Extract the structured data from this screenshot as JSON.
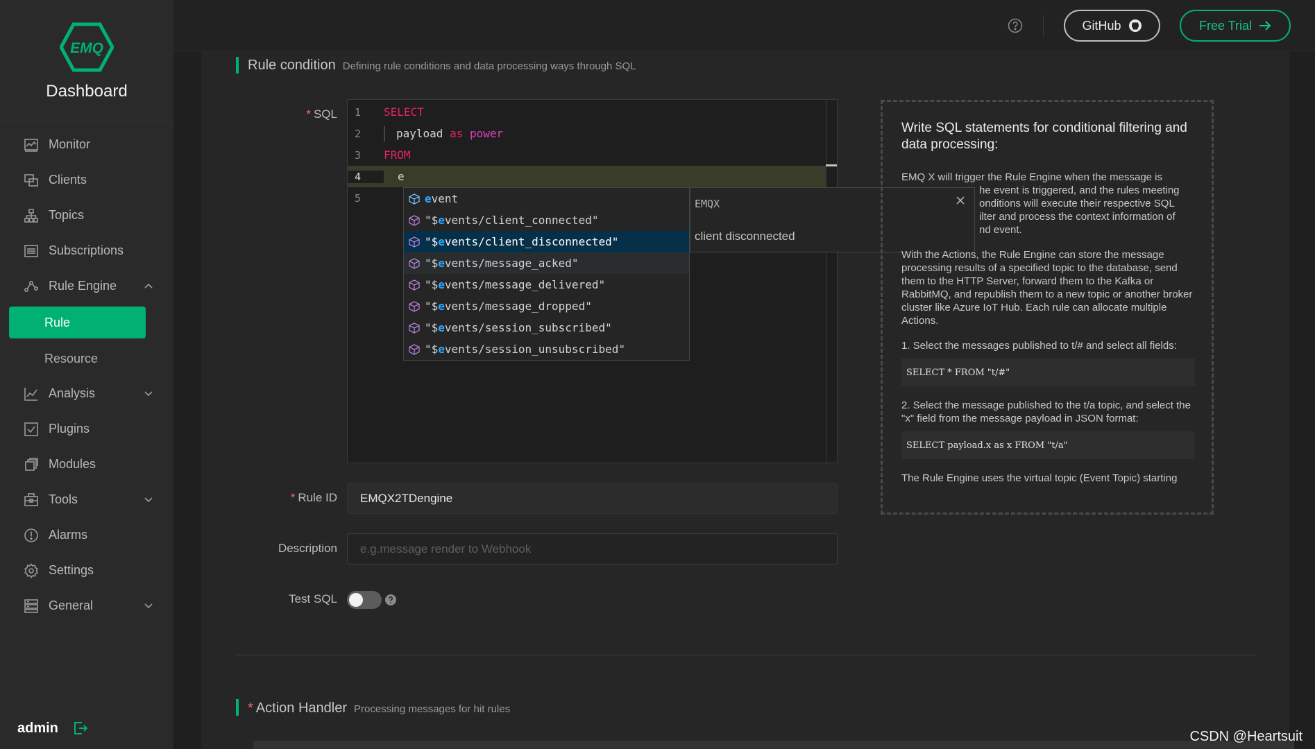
{
  "brand": {
    "logo_text": "EMQ",
    "title": "Dashboard"
  },
  "sidebar": {
    "items": [
      {
        "label": "Monitor",
        "icon": "monitor-icon"
      },
      {
        "label": "Clients",
        "icon": "clients-icon"
      },
      {
        "label": "Topics",
        "icon": "topics-icon"
      },
      {
        "label": "Subscriptions",
        "icon": "subscriptions-icon"
      },
      {
        "label": "Rule Engine",
        "icon": "rule-engine-icon",
        "expanded": true
      },
      {
        "label": "Rule",
        "active": true
      },
      {
        "label": "Resource"
      },
      {
        "label": "Analysis",
        "icon": "analysis-icon"
      },
      {
        "label": "Plugins",
        "icon": "plugins-icon"
      },
      {
        "label": "Modules",
        "icon": "modules-icon"
      },
      {
        "label": "Tools",
        "icon": "tools-icon"
      },
      {
        "label": "Alarms",
        "icon": "alarms-icon"
      },
      {
        "label": "Settings",
        "icon": "settings-icon"
      },
      {
        "label": "General",
        "icon": "general-icon"
      }
    ],
    "user": "admin"
  },
  "topbar": {
    "github_label": "GitHub",
    "trial_label": "Free Trial"
  },
  "rule_condition": {
    "title": "Rule condition",
    "subtitle": "Defining rule conditions and data processing ways through SQL",
    "sql_label": "SQL",
    "line_numbers": [
      "1",
      "2",
      "3",
      "4",
      "5"
    ],
    "code": {
      "l1_kw": "SELECT",
      "l2_field": "payload",
      "l2_as": "as",
      "l2_alias": "power",
      "l3_kw": "FROM",
      "l4_text": "e"
    },
    "suggestions": [
      {
        "prefix": "",
        "match": "e",
        "rest": "vent"
      },
      {
        "prefix": "\"$",
        "match": "e",
        "rest": "vents/client_connected\""
      },
      {
        "prefix": "\"$",
        "match": "e",
        "rest": "vents/client_disconnected\""
      },
      {
        "prefix": "\"$",
        "match": "e",
        "rest": "vents/message_acked\""
      },
      {
        "prefix": "\"$",
        "match": "e",
        "rest": "vents/message_delivered\""
      },
      {
        "prefix": "\"$",
        "match": "e",
        "rest": "vents/message_dropped\""
      },
      {
        "prefix": "\"$",
        "match": "e",
        "rest": "vents/session_subscribed\""
      },
      {
        "prefix": "\"$",
        "match": "e",
        "rest": "vents/session_unsubscribed\""
      }
    ],
    "selected_suggestion": 2,
    "detail": {
      "title": "EMQX",
      "body": "client disconnected"
    }
  },
  "form": {
    "rule_id_label": "Rule ID",
    "rule_id_value": "EMQX2TDengine",
    "description_label": "Description",
    "description_placeholder": "e.g.message render to Webhook",
    "test_sql_label": "Test SQL",
    "test_sql_enabled": false
  },
  "help": {
    "heading": "Write SQL statements for conditional filtering and data processing:",
    "p1": "EMQ X will trigger the Rule Engine when the message is ...he event is triggered, and the rules meeting ...onditions will execute their respective SQL ...ilter and process the context information of ...nd event.",
    "p1_lines": [
      "EMQ X will trigger the Rule Engine when the message is",
      "he event is triggered, and the rules meeting",
      "onditions will execute their respective SQL",
      "ilter and process the context information of",
      "nd event."
    ],
    "p2": "With the Actions, the Rule Engine can store the message processing results of a specified topic to the database, send them to the HTTP Server, forward them to the Kafka or RabbitMQ, and republish them to a new topic or another broker cluster like Azure IoT Hub. Each rule can allocate multiple Actions.",
    "p3": "1. Select the messages published to t/# and select all fields:",
    "code1": "SELECT * FROM \"t/#\"",
    "p4": "2. Select the message published to the t/a topic, and select the \"x\" field from the message payload in JSON format:",
    "code2": "SELECT payload.x as x FROM \"t/a\"",
    "p5": "The Rule Engine uses the virtual topic (Event Topic) starting"
  },
  "action_handler": {
    "title": "Action Handler",
    "subtitle": "Processing messages for hit rules"
  },
  "watermark": "CSDN @Heartsuit",
  "colors": {
    "accent": "#00b173",
    "keyword": "#e8245f",
    "alias": "#e23ebd",
    "match": "#2aaaff"
  }
}
